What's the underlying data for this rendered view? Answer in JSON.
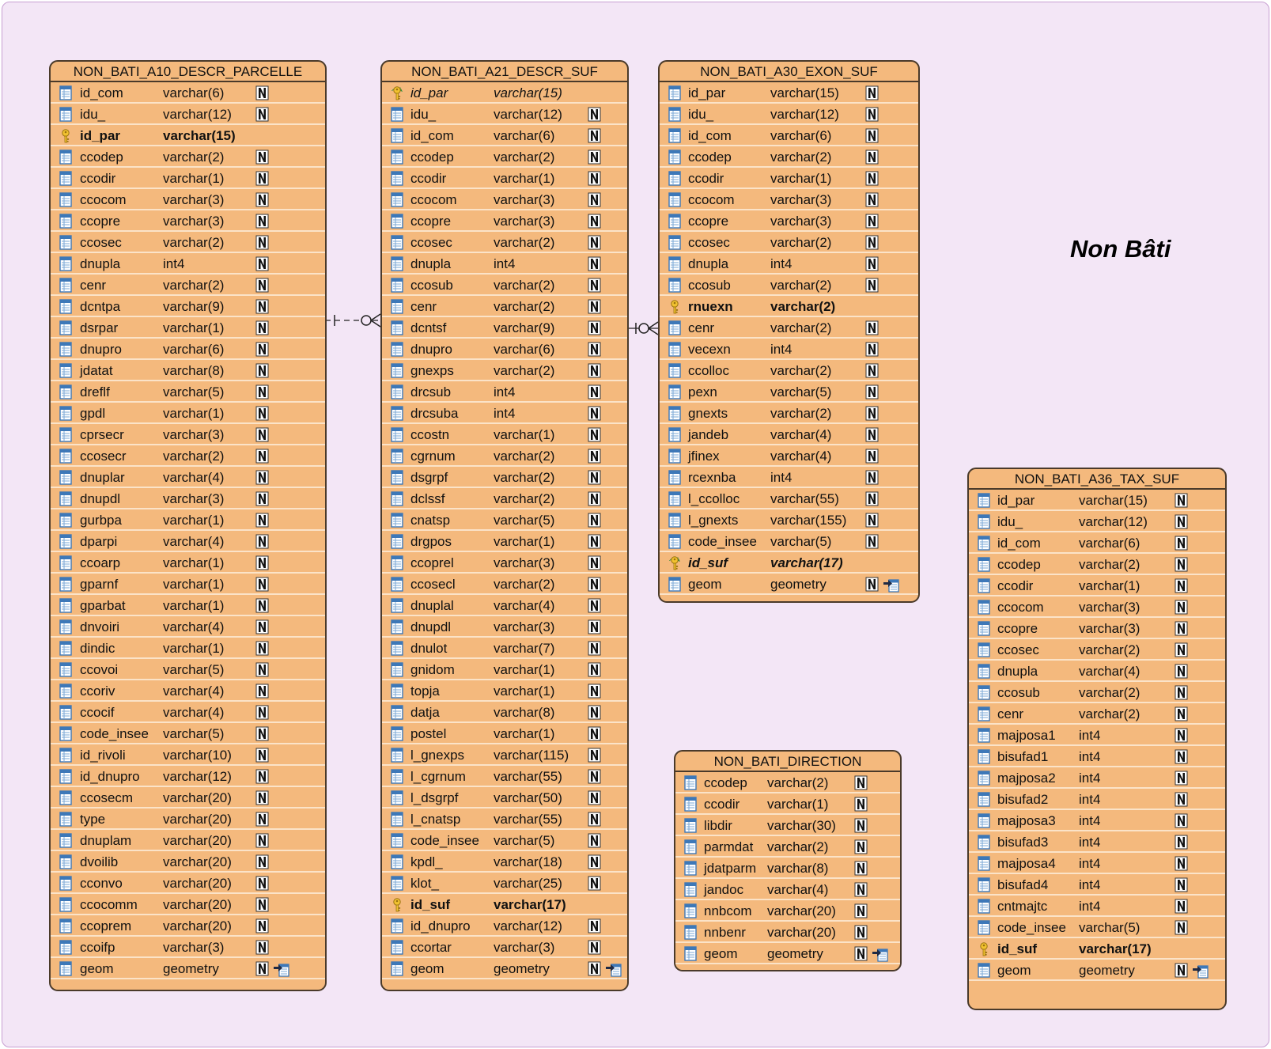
{
  "package": {
    "title": "Non Bâti"
  },
  "tables": [
    {
      "name": "NON_BATI_A10_DESCR_PARCELLE",
      "columns": [
        {
          "name": "id_com",
          "type": "varchar(6)",
          "nullable": true
        },
        {
          "name": "idu_",
          "type": "varchar(12)",
          "nullable": true
        },
        {
          "name": "id_par",
          "type": "varchar(15)",
          "key": "pk",
          "nullable": false
        },
        {
          "name": "ccodep",
          "type": "varchar(2)",
          "nullable": true
        },
        {
          "name": "ccodir",
          "type": "varchar(1)",
          "nullable": true
        },
        {
          "name": "ccocom",
          "type": "varchar(3)",
          "nullable": true
        },
        {
          "name": "ccopre",
          "type": "varchar(3)",
          "nullable": true
        },
        {
          "name": "ccosec",
          "type": "varchar(2)",
          "nullable": true
        },
        {
          "name": "dnupla",
          "type": "int4",
          "nullable": true
        },
        {
          "name": "cenr",
          "type": "varchar(2)",
          "nullable": true
        },
        {
          "name": "dcntpa",
          "type": "varchar(9)",
          "nullable": true
        },
        {
          "name": "dsrpar",
          "type": "varchar(1)",
          "nullable": true
        },
        {
          "name": "dnupro",
          "type": "varchar(6)",
          "nullable": true
        },
        {
          "name": "jdatat",
          "type": "varchar(8)",
          "nullable": true
        },
        {
          "name": "dreflf",
          "type": "varchar(5)",
          "nullable": true
        },
        {
          "name": "gpdl",
          "type": "varchar(1)",
          "nullable": true
        },
        {
          "name": "cprsecr",
          "type": "varchar(3)",
          "nullable": true
        },
        {
          "name": "ccosecr",
          "type": "varchar(2)",
          "nullable": true
        },
        {
          "name": "dnuplar",
          "type": "varchar(4)",
          "nullable": true
        },
        {
          "name": "dnupdl",
          "type": "varchar(3)",
          "nullable": true
        },
        {
          "name": "gurbpa",
          "type": "varchar(1)",
          "nullable": true
        },
        {
          "name": "dparpi",
          "type": "varchar(4)",
          "nullable": true
        },
        {
          "name": "ccoarp",
          "type": "varchar(1)",
          "nullable": true
        },
        {
          "name": "gparnf",
          "type": "varchar(1)",
          "nullable": true
        },
        {
          "name": "gparbat",
          "type": "varchar(1)",
          "nullable": true
        },
        {
          "name": "dnvoiri",
          "type": "varchar(4)",
          "nullable": true
        },
        {
          "name": "dindic",
          "type": "varchar(1)",
          "nullable": true
        },
        {
          "name": "ccovoi",
          "type": "varchar(5)",
          "nullable": true
        },
        {
          "name": "ccoriv",
          "type": "varchar(4)",
          "nullable": true
        },
        {
          "name": "ccocif",
          "type": "varchar(4)",
          "nullable": true
        },
        {
          "name": "code_insee",
          "type": "varchar(5)",
          "nullable": true
        },
        {
          "name": "id_rivoli",
          "type": "varchar(10)",
          "nullable": true
        },
        {
          "name": "id_dnupro",
          "type": "varchar(12)",
          "nullable": true
        },
        {
          "name": "ccosecm",
          "type": "varchar(20)",
          "nullable": true
        },
        {
          "name": "type",
          "type": "varchar(20)",
          "nullable": true
        },
        {
          "name": "dnuplam",
          "type": "varchar(20)",
          "nullable": true
        },
        {
          "name": "dvoilib",
          "type": "varchar(20)",
          "nullable": true
        },
        {
          "name": "cconvo",
          "type": "varchar(20)",
          "nullable": true
        },
        {
          "name": "ccocomm",
          "type": "varchar(20)",
          "nullable": true
        },
        {
          "name": "ccoprem",
          "type": "varchar(20)",
          "nullable": true
        },
        {
          "name": "ccoifp",
          "type": "varchar(3)",
          "nullable": true
        },
        {
          "name": "geom",
          "type": "geometry",
          "nullable": true,
          "spatial": true
        }
      ]
    },
    {
      "name": "NON_BATI_A21_DESCR_SUF",
      "columns": [
        {
          "name": "id_par",
          "type": "varchar(15)",
          "key": "fk",
          "nullable": false
        },
        {
          "name": "idu_",
          "type": "varchar(12)",
          "nullable": true
        },
        {
          "name": "id_com",
          "type": "varchar(6)",
          "nullable": true
        },
        {
          "name": "ccodep",
          "type": "varchar(2)",
          "nullable": true
        },
        {
          "name": "ccodir",
          "type": "varchar(1)",
          "nullable": true
        },
        {
          "name": "ccocom",
          "type": "varchar(3)",
          "nullable": true
        },
        {
          "name": "ccopre",
          "type": "varchar(3)",
          "nullable": true
        },
        {
          "name": "ccosec",
          "type": "varchar(2)",
          "nullable": true
        },
        {
          "name": "dnupla",
          "type": "int4",
          "nullable": true
        },
        {
          "name": "ccosub",
          "type": "varchar(2)",
          "nullable": true
        },
        {
          "name": "cenr",
          "type": "varchar(2)",
          "nullable": true
        },
        {
          "name": "dcntsf",
          "type": "varchar(9)",
          "nullable": true
        },
        {
          "name": "dnupro",
          "type": "varchar(6)",
          "nullable": true
        },
        {
          "name": "gnexps",
          "type": "varchar(2)",
          "nullable": true
        },
        {
          "name": "drcsub",
          "type": "int4",
          "nullable": true
        },
        {
          "name": "drcsuba",
          "type": "int4",
          "nullable": true
        },
        {
          "name": "ccostn",
          "type": "varchar(1)",
          "nullable": true
        },
        {
          "name": "cgrnum",
          "type": "varchar(2)",
          "nullable": true
        },
        {
          "name": "dsgrpf",
          "type": "varchar(2)",
          "nullable": true
        },
        {
          "name": "dclssf",
          "type": "varchar(2)",
          "nullable": true
        },
        {
          "name": "cnatsp",
          "type": "varchar(5)",
          "nullable": true
        },
        {
          "name": "drgpos",
          "type": "varchar(1)",
          "nullable": true
        },
        {
          "name": "ccoprel",
          "type": "varchar(3)",
          "nullable": true
        },
        {
          "name": "ccosecl",
          "type": "varchar(2)",
          "nullable": true
        },
        {
          "name": "dnuplal",
          "type": "varchar(4)",
          "nullable": true
        },
        {
          "name": "dnupdl",
          "type": "varchar(3)",
          "nullable": true
        },
        {
          "name": "dnulot",
          "type": "varchar(7)",
          "nullable": true
        },
        {
          "name": "gnidom",
          "type": "varchar(1)",
          "nullable": true
        },
        {
          "name": "topja",
          "type": "varchar(1)",
          "nullable": true
        },
        {
          "name": "datja",
          "type": "varchar(8)",
          "nullable": true
        },
        {
          "name": "postel",
          "type": "varchar(1)",
          "nullable": true
        },
        {
          "name": "l_gnexps",
          "type": "varchar(115)",
          "nullable": true
        },
        {
          "name": "l_cgrnum",
          "type": "varchar(55)",
          "nullable": true
        },
        {
          "name": "l_dsgrpf",
          "type": "varchar(50)",
          "nullable": true
        },
        {
          "name": "l_cnatsp",
          "type": "varchar(55)",
          "nullable": true
        },
        {
          "name": "code_insee",
          "type": "varchar(5)",
          "nullable": true
        },
        {
          "name": "kpdl_",
          "type": "varchar(18)",
          "nullable": true
        },
        {
          "name": "klot_",
          "type": "varchar(25)",
          "nullable": true
        },
        {
          "name": "id_suf",
          "type": "varchar(17)",
          "key": "pk",
          "nullable": false
        },
        {
          "name": "id_dnupro",
          "type": "varchar(12)",
          "nullable": true
        },
        {
          "name": "ccortar",
          "type": "varchar(3)",
          "nullable": true
        },
        {
          "name": "geom",
          "type": "geometry",
          "nullable": true,
          "spatial": true
        }
      ]
    },
    {
      "name": "NON_BATI_A30_EXON_SUF",
      "columns": [
        {
          "name": "id_par",
          "type": "varchar(15)",
          "nullable": true
        },
        {
          "name": "idu_",
          "type": "varchar(12)",
          "nullable": true
        },
        {
          "name": "id_com",
          "type": "varchar(6)",
          "nullable": true
        },
        {
          "name": "ccodep",
          "type": "varchar(2)",
          "nullable": true
        },
        {
          "name": "ccodir",
          "type": "varchar(1)",
          "nullable": true
        },
        {
          "name": "ccocom",
          "type": "varchar(3)",
          "nullable": true
        },
        {
          "name": "ccopre",
          "type": "varchar(3)",
          "nullable": true
        },
        {
          "name": "ccosec",
          "type": "varchar(2)",
          "nullable": true
        },
        {
          "name": "dnupla",
          "type": "int4",
          "nullable": true
        },
        {
          "name": "ccosub",
          "type": "varchar(2)",
          "nullable": true
        },
        {
          "name": "rnuexn",
          "type": "varchar(2)",
          "key": "pk",
          "nullable": false
        },
        {
          "name": "cenr",
          "type": "varchar(2)",
          "nullable": true
        },
        {
          "name": "vecexn",
          "type": "int4",
          "nullable": true
        },
        {
          "name": "ccolloc",
          "type": "varchar(2)",
          "nullable": true
        },
        {
          "name": "pexn",
          "type": "varchar(5)",
          "nullable": true
        },
        {
          "name": "gnexts",
          "type": "varchar(2)",
          "nullable": true
        },
        {
          "name": "jandeb",
          "type": "varchar(4)",
          "nullable": true
        },
        {
          "name": "jfinex",
          "type": "varchar(4)",
          "nullable": true
        },
        {
          "name": "rcexnba",
          "type": "int4",
          "nullable": true
        },
        {
          "name": "l_ccolloc",
          "type": "varchar(55)",
          "nullable": true
        },
        {
          "name": "l_gnexts",
          "type": "varchar(155)",
          "nullable": true
        },
        {
          "name": "code_insee",
          "type": "varchar(5)",
          "nullable": true
        },
        {
          "name": "id_suf",
          "type": "varchar(17)",
          "key": "pkfk",
          "nullable": false
        },
        {
          "name": "geom",
          "type": "geometry",
          "nullable": true,
          "spatial": true
        }
      ]
    },
    {
      "name": "NON_BATI_A36_TAX_SUF",
      "columns": [
        {
          "name": "id_par",
          "type": "varchar(15)",
          "nullable": true
        },
        {
          "name": "idu_",
          "type": "varchar(12)",
          "nullable": true
        },
        {
          "name": "id_com",
          "type": "varchar(6)",
          "nullable": true
        },
        {
          "name": "ccodep",
          "type": "varchar(2)",
          "nullable": true
        },
        {
          "name": "ccodir",
          "type": "varchar(1)",
          "nullable": true
        },
        {
          "name": "ccocom",
          "type": "varchar(3)",
          "nullable": true
        },
        {
          "name": "ccopre",
          "type": "varchar(3)",
          "nullable": true
        },
        {
          "name": "ccosec",
          "type": "varchar(2)",
          "nullable": true
        },
        {
          "name": "dnupla",
          "type": "varchar(4)",
          "nullable": true
        },
        {
          "name": "ccosub",
          "type": "varchar(2)",
          "nullable": true
        },
        {
          "name": "cenr",
          "type": "varchar(2)",
          "nullable": true
        },
        {
          "name": "majposa1",
          "type": "int4",
          "nullable": true
        },
        {
          "name": "bisufad1",
          "type": "int4",
          "nullable": true
        },
        {
          "name": "majposa2",
          "type": "int4",
          "nullable": true
        },
        {
          "name": "bisufad2",
          "type": "int4",
          "nullable": true
        },
        {
          "name": "majposa3",
          "type": "int4",
          "nullable": true
        },
        {
          "name": "bisufad3",
          "type": "int4",
          "nullable": true
        },
        {
          "name": "majposa4",
          "type": "int4",
          "nullable": true
        },
        {
          "name": "bisufad4",
          "type": "int4",
          "nullable": true
        },
        {
          "name": "cntmajtc",
          "type": "int4",
          "nullable": true
        },
        {
          "name": "code_insee",
          "type": "varchar(5)",
          "nullable": true
        },
        {
          "name": "id_suf",
          "type": "varchar(17)",
          "key": "pk",
          "nullable": false
        },
        {
          "name": "geom",
          "type": "geometry",
          "nullable": true,
          "spatial": true
        }
      ]
    },
    {
      "name": "NON_BATI_DIRECTION",
      "columns": [
        {
          "name": "ccodep",
          "type": "varchar(2)",
          "nullable": true
        },
        {
          "name": "ccodir",
          "type": "varchar(1)",
          "nullable": true
        },
        {
          "name": "libdir",
          "type": "varchar(30)",
          "nullable": true
        },
        {
          "name": "parmdat",
          "type": "varchar(2)",
          "nullable": true
        },
        {
          "name": "jdatparm",
          "type": "varchar(8)",
          "nullable": true
        },
        {
          "name": "jandoc",
          "type": "varchar(4)",
          "nullable": true
        },
        {
          "name": "nnbcom",
          "type": "varchar(20)",
          "nullable": true
        },
        {
          "name": "nnbenr",
          "type": "varchar(20)",
          "nullable": true
        },
        {
          "name": "geom",
          "type": "geometry",
          "nullable": true,
          "spatial": true
        }
      ]
    }
  ],
  "relationships": [
    {
      "from": "NON_BATI_A10_DESCR_PARCELLE",
      "to": "NON_BATI_A21_DESCR_SUF",
      "parent_end": "one (mandatory)",
      "child_end": "zero or many",
      "style": "dashed"
    },
    {
      "from": "NON_BATI_A21_DESCR_SUF",
      "to": "NON_BATI_A30_EXON_SUF",
      "parent_end": "one (mandatory)",
      "child_end": "zero or many",
      "style": "solid"
    }
  ]
}
